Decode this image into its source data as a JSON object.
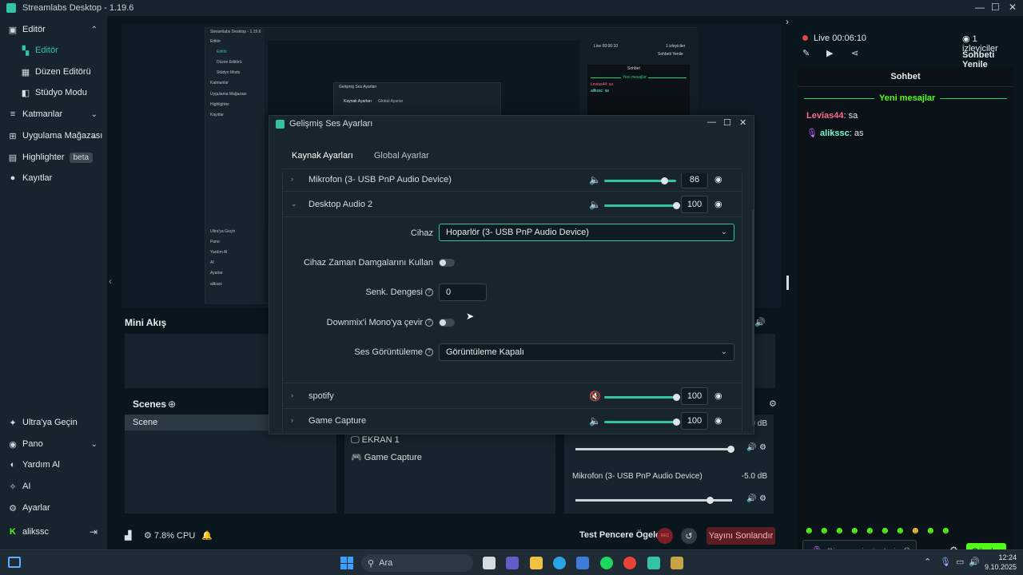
{
  "window": {
    "title": "Streamlabs Desktop - 1.19.6",
    "controls": {
      "minimize": "—",
      "maximize": "☐",
      "close": "✕"
    }
  },
  "sidebar": {
    "top_items": [
      {
        "label": "Editör",
        "icon": "editor-icon",
        "chevron": "⌃"
      },
      {
        "label": "Editör",
        "icon": "editor-sub-icon",
        "active": true
      },
      {
        "label": "Düzen Editörü",
        "icon": "layout-editor-icon"
      },
      {
        "label": "Stüdyo Modu",
        "icon": "studio-mode-icon"
      },
      {
        "label": "Katmanlar",
        "icon": "layers-icon",
        "chevron": "⌄"
      },
      {
        "label": "Uygulama Mağazası",
        "icon": "app-store-icon",
        "chevron": "⌄"
      },
      {
        "label": "Highlighter",
        "icon": "highlighter-icon",
        "badge": "beta"
      },
      {
        "label": "Kayıtlar",
        "icon": "recordings-icon"
      }
    ],
    "bottom_items": [
      {
        "label": "Ultra'ya Geçin",
        "icon": "ultra-icon"
      },
      {
        "label": "Pano",
        "icon": "dashboard-icon",
        "chevron": "⌄"
      },
      {
        "label": "Yardım Al",
        "icon": "help-icon"
      },
      {
        "label": "AI",
        "icon": "ai-icon"
      },
      {
        "label": "Ayarlar",
        "icon": "settings-icon"
      },
      {
        "label": "alikssc",
        "icon": "kick-icon"
      }
    ]
  },
  "nested_preview": {
    "title": "Streamlabs Desktop - 1.19.6",
    "rows": [
      "Editör",
      "Editör",
      "Düzen Editörü",
      "Stüdyo Modu",
      "Katmanlar",
      "Uygulama Mağazası",
      "Highlighter",
      "Kayıtlar"
    ],
    "bottom_rows": [
      "Ultra'ya Geçin",
      "Pano",
      "Yardım Al",
      "AI",
      "Ayarlar",
      "alikssc"
    ],
    "live": "Live 00:06:10",
    "viewers": "1 izleyiciler",
    "chat_title": "Sohbet",
    "refresh": "Sohbeti Yenile",
    "new_messages": "Yeni mesajlar",
    "msg1": "Levias44: sa",
    "msg2": "alikssc: as",
    "inner_dialog_title": "Gelişmiş Ses Ayarları",
    "inner_tabs": [
      "Kaynak Ayarları",
      "Global Ayarlar"
    ]
  },
  "dialog": {
    "title": "Gelişmiş Ses Ayarları",
    "tabs": [
      "Kaynak Ayarları",
      "Global Ayarlar"
    ],
    "sources": [
      {
        "name": "Mikrofon (3- USB PnP Audio Device)",
        "volume": "86",
        "level": 0.82,
        "muted": false
      },
      {
        "name": "Desktop Audio 2",
        "volume": "100",
        "level": 1.0,
        "muted": false
      },
      {
        "name": "spotify",
        "volume": "100",
        "level": 1.0,
        "muted": true
      },
      {
        "name": "Game Capture",
        "volume": "100",
        "level": 1.0,
        "muted": false
      }
    ],
    "fields": {
      "device_label": "Cihaz",
      "device_value": "Hoparlör (3- USB PnP Audio Device)",
      "timestamps_label": "Cihaz Zaman Damgalarını Kullan",
      "sync_label": "Senk. Dengesi",
      "sync_value": "0",
      "downmix_label": "Downmix'i Mono'ya çevir",
      "monitoring_label": "Ses Görüntüleme",
      "monitoring_value": "Görüntüleme Kapalı"
    }
  },
  "mini_akis": {
    "title": "Mini Akış"
  },
  "scenes": {
    "title": "Scenes",
    "items": [
      "Scene"
    ],
    "sources": [
      "EKRAN 1",
      "Game Capture"
    ]
  },
  "mixer": {
    "top_db": "0 dB",
    "mic_name": "Mikrofon (3- USB PnP Audio Device)",
    "mic_db": "-5.0 dB"
  },
  "statusbar": {
    "cpu": "7.8% CPU",
    "test_label": "Test Pencere Ögeleri",
    "rec_label": "REC",
    "end_stream": "Yayını Sonlandır"
  },
  "right_panel": {
    "live": "Live 00:06:10",
    "viewers": "1 izleyiciler",
    "refresh": "Sohbeti Yenile",
    "chat_title": "Sohbet",
    "new_messages": "Yeni mesajlar",
    "messages": [
      {
        "user": "Levias44",
        "text": ": sa",
        "color": "#ff6b8a"
      },
      {
        "user": "alikssc",
        "text": ": as",
        "color": "#80f5d2"
      }
    ],
    "input_placeholder": "Bir mesaj gönderin",
    "send": "Gönder"
  },
  "taskbar": {
    "search": "Ara",
    "time": "12:24",
    "date": "9.10.2025"
  },
  "colors": {
    "accent": "#31c3a2",
    "kick_green": "#53fc18",
    "end_red": "#5a1d24"
  }
}
